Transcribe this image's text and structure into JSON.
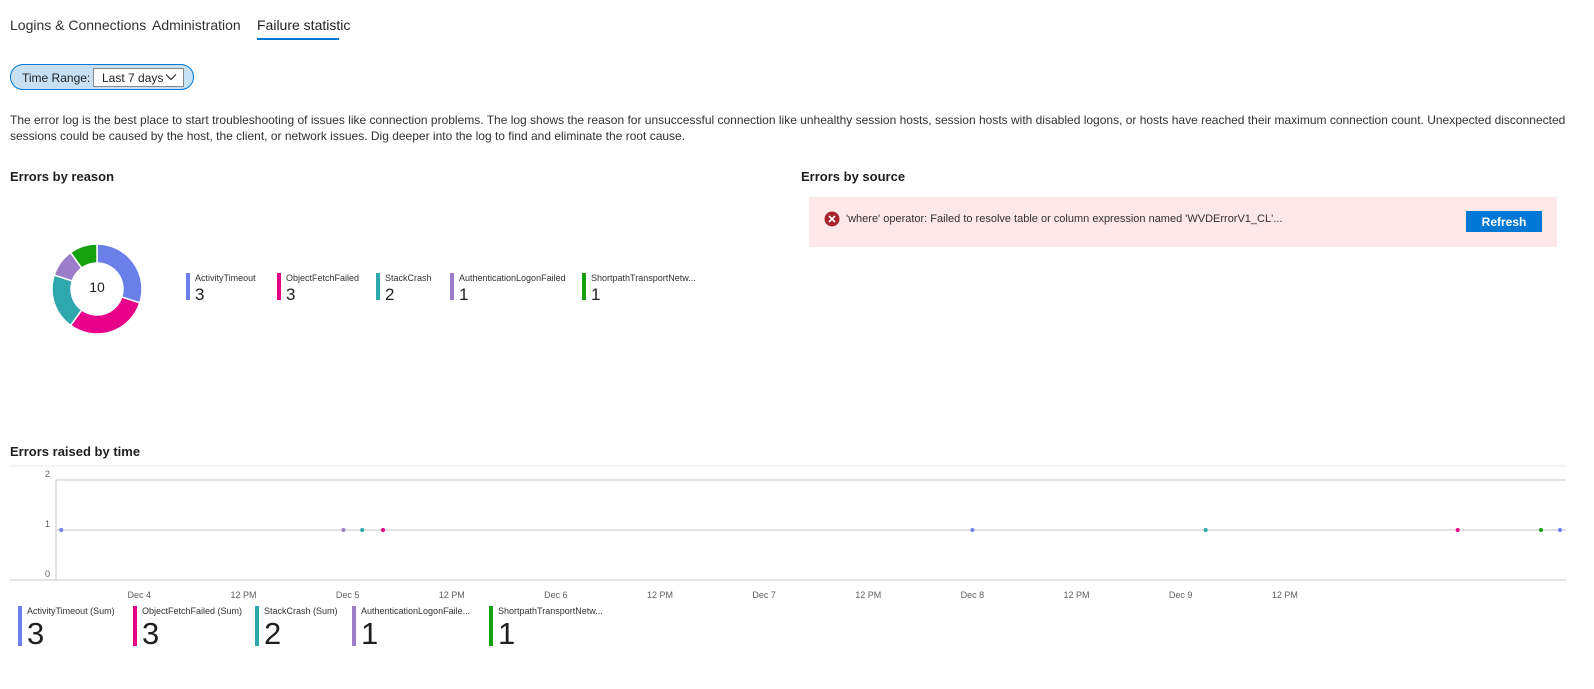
{
  "tabs": [
    {
      "label": "Logins & Connections",
      "active": false
    },
    {
      "label": "Administration",
      "active": false
    },
    {
      "label": "Failure statistic",
      "active": true
    }
  ],
  "time_range": {
    "label": "Time Range:",
    "value": "Last 7 days",
    "icon": "chevron-down-icon"
  },
  "description": "The error log is the best place to start troubleshooting of issues like connection problems. The log shows the reason for unsuccessful connection like unhealthy session hosts, session hosts with disabled logons, or hosts have reached their maximum connection count. Unexpected disconnected sessions could be caused by the host, the client, or network issues. Dig deeper into the log to find and eliminate the root cause.",
  "errors_by_reason": {
    "title": "Errors by reason",
    "total": "10",
    "legend": [
      {
        "name": "ActivityTimeout",
        "value": "3",
        "color": "#6b7fe8"
      },
      {
        "name": "ObjectFetchFailed",
        "value": "3",
        "color": "#e8008a"
      },
      {
        "name": "StackCrash",
        "value": "2",
        "color": "#2ea8ad"
      },
      {
        "name": "AuthenticationLogonFailed",
        "value": "1",
        "color": "#9b7dc9"
      },
      {
        "name": "ShortpathTransportNetw...",
        "value": "1",
        "color": "#13a10e"
      }
    ]
  },
  "errors_by_source": {
    "title": "Errors by source",
    "error_message": "'where' operator: Failed to resolve table or column expression named 'WVDErrorV1_CL'...",
    "error_icon": "error-circle-icon",
    "refresh_label": "Refresh"
  },
  "errors_by_time": {
    "title": "Errors raised by time",
    "legend": [
      {
        "name": "ActivityTimeout (Sum)",
        "value": "3",
        "color": "#6b7fe8"
      },
      {
        "name": "ObjectFetchFailed (Sum)",
        "value": "3",
        "color": "#e8008a"
      },
      {
        "name": "StackCrash (Sum)",
        "value": "2",
        "color": "#2ea8ad"
      },
      {
        "name": "AuthenticationLogonFaile...",
        "value": "1",
        "color": "#9b7dc9"
      },
      {
        "name": "ShortpathTransportNetw...",
        "value": "1",
        "color": "#13a10e"
      }
    ]
  },
  "chart_data": [
    {
      "type": "pie",
      "title": "Errors by reason",
      "center_label": "10",
      "labels": [
        "ActivityTimeout",
        "ObjectFetchFailed",
        "StackCrash",
        "AuthenticationLogonFailed",
        "ShortpathTransportNetw..."
      ],
      "values": [
        3,
        3,
        2,
        1,
        1
      ],
      "colors": [
        "#6b7fe8",
        "#e8008a",
        "#2ea8ad",
        "#9b7dc9",
        "#13a10e"
      ]
    },
    {
      "type": "scatter",
      "title": "Errors raised by time",
      "x_ticks": [
        "Dec 4",
        "12 PM",
        "Dec 5",
        "12 PM",
        "Dec 6",
        "12 PM",
        "Dec 7",
        "12 PM",
        "Dec 8",
        "12 PM",
        "Dec 9",
        "12 PM"
      ],
      "x_tick_pos": [
        3.5,
        4.0,
        4.5,
        5.0,
        5.5,
        6.0,
        6.5,
        7.0,
        7.5,
        8.0,
        8.5,
        9.0
      ],
      "x_range": [
        3.1,
        10.35
      ],
      "ylim": [
        0,
        2
      ],
      "y_ticks": [
        0,
        1,
        2
      ],
      "grid": true,
      "series": [
        {
          "name": "ActivityTimeout (Sum)",
          "color": "#6b7fe8",
          "points": [
            [
              3.125,
              1
            ],
            [
              7.5,
              1
            ],
            [
              10.35,
              1
            ]
          ]
        },
        {
          "name": "ObjectFetchFailed (Sum)",
          "color": "#e8008a",
          "points": [
            [
              4.67,
              1
            ],
            [
              9.83,
              1
            ]
          ]
        },
        {
          "name": "StackCrash (Sum)",
          "color": "#2ea8ad",
          "points": [
            [
              4.57,
              1
            ],
            [
              8.62,
              1
            ]
          ]
        },
        {
          "name": "AuthenticationLogonFaile...",
          "color": "#9b7dc9",
          "points": [
            [
              4.48,
              1
            ]
          ]
        },
        {
          "name": "ShortpathTransportNetw...",
          "color": "#13a10e",
          "points": [
            [
              10.23,
              1
            ]
          ]
        }
      ]
    }
  ]
}
